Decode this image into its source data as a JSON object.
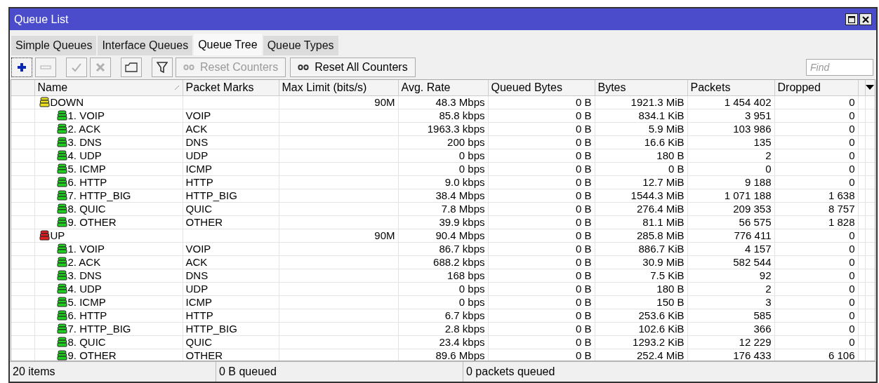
{
  "window": {
    "title": "Queue List"
  },
  "tabs": [
    {
      "label": "Simple Queues",
      "selected": false
    },
    {
      "label": "Interface Queues",
      "selected": false
    },
    {
      "label": "Queue Tree",
      "selected": true
    },
    {
      "label": "Queue Types",
      "selected": false
    }
  ],
  "toolbar": [
    {
      "kind": "add",
      "disabled": false
    },
    {
      "kind": "remove",
      "disabled": true
    },
    {
      "kind": "enable",
      "disabled": true
    },
    {
      "kind": "disable",
      "disabled": true
    },
    {
      "kind": "comment",
      "disabled": false
    },
    {
      "kind": "filter",
      "disabled": false
    },
    {
      "kind": "reset",
      "label": "Reset Counters",
      "disabled": true
    },
    {
      "kind": "reset",
      "label": "Reset All Counters",
      "disabled": false
    }
  ],
  "find": {
    "placeholder": "Find"
  },
  "table": {
    "columns": [
      {
        "label": "Name",
        "sorted": true
      },
      {
        "label": "Packet Marks",
        "sorted": false
      },
      {
        "label": "Max Limit (bits/s)",
        "sorted": false
      },
      {
        "label": "Avg. Rate",
        "sorted": false
      },
      {
        "label": "Queued Bytes",
        "sorted": false
      },
      {
        "label": "Bytes",
        "sorted": false
      },
      {
        "label": "Packets",
        "sorted": false
      },
      {
        "label": "Dropped",
        "sorted": false
      }
    ],
    "rows": [
      {
        "name": "DOWN",
        "max_limit": "90M",
        "avg_rate": "48.3 Mbps",
        "queued_bytes": "0 B",
        "bytes": "1921.3 MiB",
        "packets": "1 454 402",
        "dropped": "0",
        "color": "#e8e020",
        "children": [
          {
            "name": "1. VOIP",
            "packet_marks": "VOIP",
            "avg_rate": "85.8 kbps",
            "queued_bytes": "0 B",
            "bytes": "834.1 KiB",
            "packets": "3 951",
            "dropped": "0",
            "color": "#20d020"
          },
          {
            "name": "2. ACK",
            "packet_marks": "ACK",
            "avg_rate": "1963.3 kbps",
            "queued_bytes": "0 B",
            "bytes": "5.9 MiB",
            "packets": "103 986",
            "dropped": "0",
            "color": "#20d020"
          },
          {
            "name": "3. DNS",
            "packet_marks": "DNS",
            "avg_rate": "200 bps",
            "queued_bytes": "0 B",
            "bytes": "16.6 KiB",
            "packets": "135",
            "dropped": "0",
            "color": "#20d020"
          },
          {
            "name": "4. UDP",
            "packet_marks": "UDP",
            "avg_rate": "0 bps",
            "queued_bytes": "0 B",
            "bytes": "180 B",
            "packets": "2",
            "dropped": "0",
            "color": "#20d020"
          },
          {
            "name": "5. ICMP",
            "packet_marks": "ICMP",
            "avg_rate": "0 bps",
            "queued_bytes": "0 B",
            "bytes": "0 B",
            "packets": "0",
            "dropped": "0",
            "color": "#20d020"
          },
          {
            "name": "6. HTTP",
            "packet_marks": "HTTP",
            "avg_rate": "9.0 kbps",
            "queued_bytes": "0 B",
            "bytes": "12.7 MiB",
            "packets": "9 188",
            "dropped": "0",
            "color": "#20d020"
          },
          {
            "name": "7. HTTP_BIG",
            "packet_marks": "HTTP_BIG",
            "avg_rate": "38.4 Mbps",
            "queued_bytes": "0 B",
            "bytes": "1544.3 MiB",
            "packets": "1 071 188",
            "dropped": "1 638",
            "color": "#20d020"
          },
          {
            "name": "8. QUIC",
            "packet_marks": "QUIC",
            "avg_rate": "7.8 Mbps",
            "queued_bytes": "0 B",
            "bytes": "276.4 MiB",
            "packets": "209 353",
            "dropped": "8 757",
            "color": "#20d020"
          },
          {
            "name": "9. OTHER",
            "packet_marks": "OTHER",
            "avg_rate": "39.9 kbps",
            "queued_bytes": "0 B",
            "bytes": "81.1 MiB",
            "packets": "56 575",
            "dropped": "1 828",
            "color": "#20d020"
          }
        ]
      },
      {
        "name": "UP",
        "max_limit": "90M",
        "avg_rate": "90.4 Mbps",
        "queued_bytes": "0 B",
        "bytes": "285.8 MiB",
        "packets": "776 411",
        "dropped": "0",
        "color": "#e02020",
        "children": [
          {
            "name": "1. VOIP",
            "packet_marks": "VOIP",
            "avg_rate": "86.7 kbps",
            "queued_bytes": "0 B",
            "bytes": "886.7 KiB",
            "packets": "4 157",
            "dropped": "0",
            "color": "#20d020"
          },
          {
            "name": "2. ACK",
            "packet_marks": "ACK",
            "avg_rate": "688.2 kbps",
            "queued_bytes": "0 B",
            "bytes": "30.9 MiB",
            "packets": "582 544",
            "dropped": "0",
            "color": "#20d020"
          },
          {
            "name": "3. DNS",
            "packet_marks": "DNS",
            "avg_rate": "168 bps",
            "queued_bytes": "0 B",
            "bytes": "7.5 KiB",
            "packets": "92",
            "dropped": "0",
            "color": "#20d020"
          },
          {
            "name": "4. UDP",
            "packet_marks": "UDP",
            "avg_rate": "0 bps",
            "queued_bytes": "0 B",
            "bytes": "180 B",
            "packets": "2",
            "dropped": "0",
            "color": "#20d020"
          },
          {
            "name": "5. ICMP",
            "packet_marks": "ICMP",
            "avg_rate": "0 bps",
            "queued_bytes": "0 B",
            "bytes": "150 B",
            "packets": "3",
            "dropped": "0",
            "color": "#20d020"
          },
          {
            "name": "6. HTTP",
            "packet_marks": "HTTP",
            "avg_rate": "6.7 kbps",
            "queued_bytes": "0 B",
            "bytes": "253.6 KiB",
            "packets": "585",
            "dropped": "0",
            "color": "#20d020"
          },
          {
            "name": "7. HTTP_BIG",
            "packet_marks": "HTTP_BIG",
            "avg_rate": "2.8 kbps",
            "queued_bytes": "0 B",
            "bytes": "102.6 KiB",
            "packets": "366",
            "dropped": "0",
            "color": "#20d020"
          },
          {
            "name": "8. QUIC",
            "packet_marks": "QUIC",
            "avg_rate": "23.4 kbps",
            "queued_bytes": "0 B",
            "bytes": "1293.2 KiB",
            "packets": "12 229",
            "dropped": "0",
            "color": "#20d020"
          },
          {
            "name": "9. OTHER",
            "packet_marks": "OTHER",
            "avg_rate": "89.6 Mbps",
            "queued_bytes": "0 B",
            "bytes": "252.4 MiB",
            "packets": "176 433",
            "dropped": "6 106",
            "color": "#20d020"
          }
        ]
      }
    ]
  },
  "status_bar": [
    "20 items",
    "0 B queued",
    "0 packets queued"
  ]
}
